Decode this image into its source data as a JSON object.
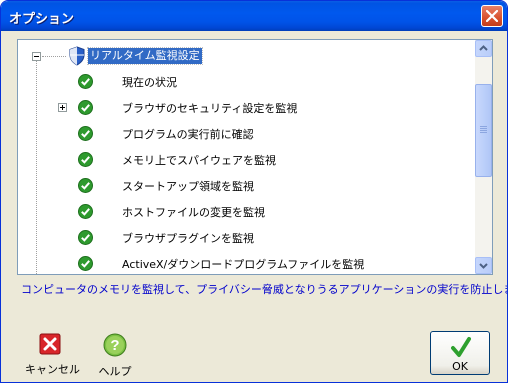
{
  "window": {
    "title": "オプション"
  },
  "tree": {
    "root_label": "リアルタイム監視設定",
    "items": [
      {
        "label": "現在の状況",
        "expandable": false
      },
      {
        "label": "ブラウザのセキュリティ設定を監視",
        "expandable": true
      },
      {
        "label": "プログラムの実行前に確認",
        "expandable": false
      },
      {
        "label": "メモリ上でスパイウェアを監視",
        "expandable": false
      },
      {
        "label": "スタートアップ領域を監視",
        "expandable": false
      },
      {
        "label": "ホストファイルの変更を監視",
        "expandable": false
      },
      {
        "label": "ブラウザプラグインを監視",
        "expandable": false
      },
      {
        "label": "ActiveX/ダウンロードプログラムファイルを監視",
        "expandable": false
      }
    ]
  },
  "description": "コンピュータのメモリを監視して、プライバシー脅威となりうるアプリケーションの実行を防止します。",
  "buttons": {
    "cancel": "キャンセル",
    "help": "ヘルプ",
    "ok": "OK"
  },
  "colors": {
    "title_bar": "#0054e3",
    "selection": "#316ac5",
    "description_text": "#0000cc",
    "check_green": "#2e9a2e"
  },
  "icons": {
    "close": "close-icon",
    "shield": "shield-icon",
    "check": "check-icon",
    "cancel": "red-x-icon",
    "help": "question-icon",
    "ok": "green-checkmark-icon"
  }
}
